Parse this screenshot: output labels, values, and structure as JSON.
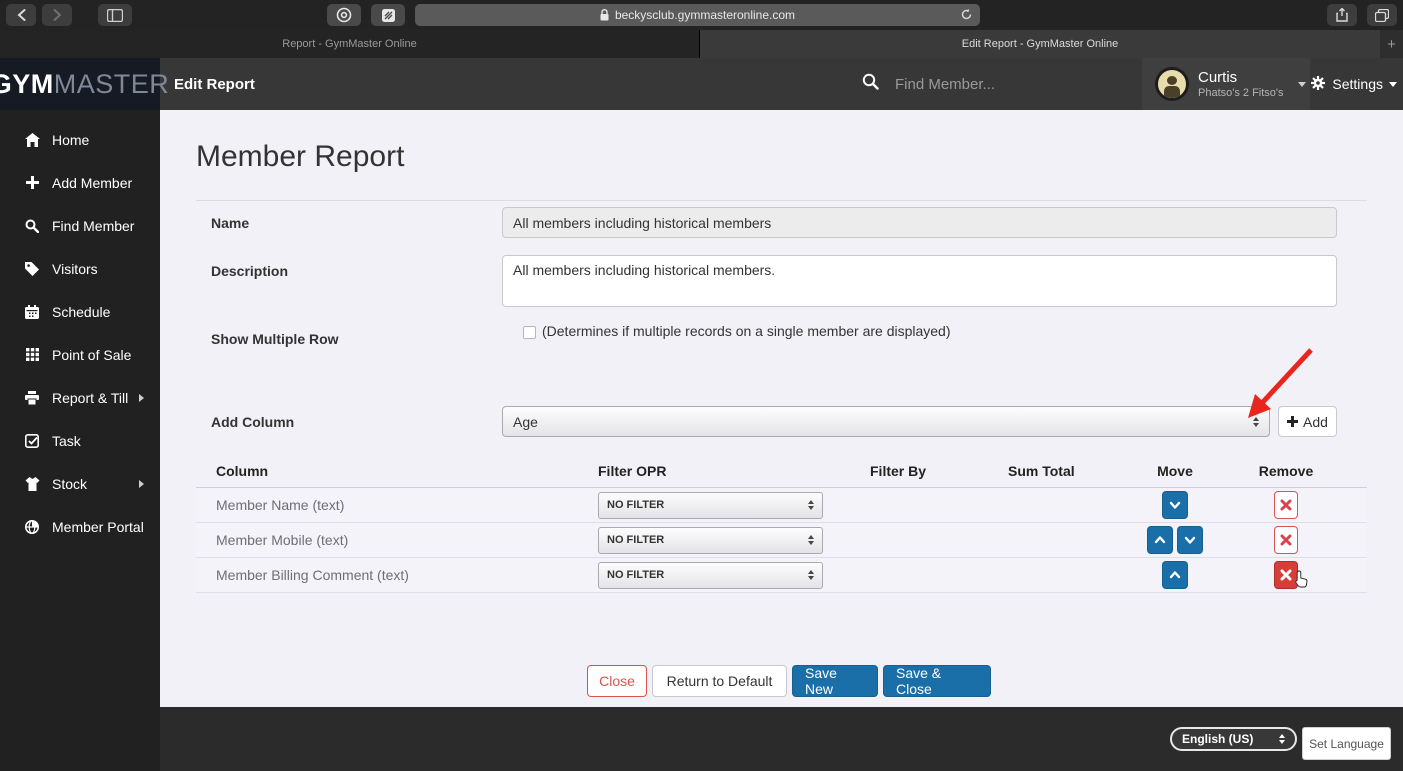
{
  "browser": {
    "url": "beckysclub.gymmasteronline.com",
    "tabs": [
      {
        "title": "Report - GymMaster Online",
        "active": false
      },
      {
        "title": "Edit Report - GymMaster Online",
        "active": true
      }
    ],
    "new_tab_label": "+"
  },
  "header": {
    "logo_gym": "GYM",
    "logo_master": "MASTER",
    "page_title": "Edit Report",
    "search_placeholder": "Find Member...",
    "user": {
      "name": "Curtis",
      "club": "Phatso's 2 Fitso's"
    },
    "settings_label": "Settings"
  },
  "sidebar": {
    "items": [
      {
        "label": "Home",
        "icon": "home-icon",
        "has_submenu": false
      },
      {
        "label": "Add Member",
        "icon": "plus-icon",
        "has_submenu": false
      },
      {
        "label": "Find Member",
        "icon": "search-icon",
        "has_submenu": false
      },
      {
        "label": "Visitors",
        "icon": "tag-icon",
        "has_submenu": false
      },
      {
        "label": "Schedule",
        "icon": "calendar-icon",
        "has_submenu": false
      },
      {
        "label": "Point of Sale",
        "icon": "grid-icon",
        "has_submenu": false
      },
      {
        "label": "Report & Till",
        "icon": "printer-icon",
        "has_submenu": true
      },
      {
        "label": "Task",
        "icon": "task-icon",
        "has_submenu": false
      },
      {
        "label": "Stock",
        "icon": "shirt-icon",
        "has_submenu": true
      },
      {
        "label": "Member Portal",
        "icon": "globe-icon",
        "has_submenu": false
      }
    ]
  },
  "main": {
    "heading": "Member Report",
    "name_field": {
      "label": "Name",
      "value": "All members including historical members"
    },
    "description_field": {
      "label": "Description",
      "value": "All members including historical members."
    },
    "show_multiple_row": {
      "label": "Show Multiple Row",
      "checkbox_label": "(Determines if multiple records on a single member are displayed)",
      "checked": false
    },
    "add_column": {
      "label": "Add Column",
      "selected_option": "Age",
      "add_button_label": "Add"
    }
  },
  "columns_table": {
    "headers": [
      "Column",
      "Filter OPR",
      "Filter By",
      "Sum Total",
      "Move",
      "Remove"
    ],
    "rows": [
      {
        "column": "Member Name (text)",
        "filter_opr": "NO FILTER",
        "move": [
          "down"
        ],
        "remove_hovered": false
      },
      {
        "column": "Member Mobile (text)",
        "filter_opr": "NO FILTER",
        "move": [
          "up",
          "down"
        ],
        "remove_hovered": false
      },
      {
        "column": "Member Billing Comment (text)",
        "filter_opr": "NO FILTER",
        "move": [
          "up"
        ],
        "remove_hovered": true
      }
    ]
  },
  "actions": {
    "close": "Close",
    "return_to_default": "Return to Default",
    "save_new": "Save New",
    "save_close": "Save & Close"
  },
  "footer": {
    "language": "English (US)",
    "set_language": "Set Language"
  },
  "colors": {
    "accent_blue": "#1a6fa8",
    "danger_red": "#d9534f",
    "arrow_red": "#e8261d"
  }
}
